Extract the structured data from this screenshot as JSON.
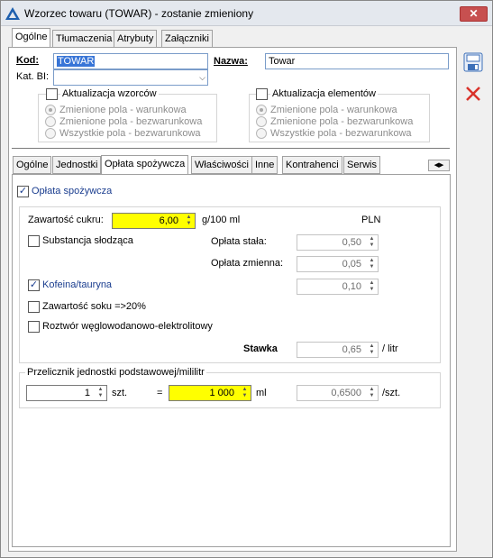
{
  "window": {
    "title": "Wzorzec towaru (TOWAR) - zostanie zmieniony",
    "close": "✕"
  },
  "top_tabs": [
    "Ogólne",
    "Tłumaczenia",
    "Atrybuty",
    "Załączniki"
  ],
  "fields": {
    "kod_label": "Kod:",
    "kod_value": "TOWAR",
    "kat_label": "Kat. BI:",
    "kat_value": "",
    "nazwa_label": "Nazwa:",
    "nazwa_value": "Towar"
  },
  "aktualizacja_wzorcow": {
    "label": "Aktualizacja wzorców",
    "options": [
      "Zmienione pola - warunkowa",
      "Zmienione pola - bezwarunkowa",
      "Wszystkie pola - bezwarunkowa"
    ]
  },
  "aktualizacja_elementow": {
    "label": "Aktualizacja elementów",
    "options": [
      "Zmienione pola - warunkowa",
      "Zmienione pola - bezwarunkowa",
      "Wszystkie pola - bezwarunkowa"
    ]
  },
  "sub_tabs": [
    "Ogólne",
    "Jednostki",
    "Opłata spożywcza",
    "Właściwości",
    "Inne",
    "Kontrahenci",
    "Serwis"
  ],
  "oplata": {
    "checkbox_label": "Opłata spożywcza",
    "zawartosc_label": "Zawartość cukru:",
    "zawartosc_value": "6,00",
    "zawartosc_unit": "g/100 ml",
    "pln": "PLN",
    "substancja": "Substancja słodząca",
    "oplata_stala_label": "Opłata stała:",
    "oplata_stala_value": "0,50",
    "oplata_zmienna_label": "Opłata zmienna:",
    "oplata_zmienna_value": "0,05",
    "kofeina": "Kofeina/tauryna",
    "kofeina_value": "0,10",
    "sok": "Zawartość soku =>20%",
    "roztwor": "Roztwór węglowodanowo-elektrolitowy",
    "stawka_label": "Stawka",
    "stawka_value": "0,65",
    "stawka_unit": "/ litr"
  },
  "przelicznik": {
    "label": "Przelicznik jednostki podstawowej/mililitr",
    "left_value": "1",
    "left_unit": "szt.",
    "equals": "=",
    "right_value": "1 000",
    "right_unit": "ml",
    "result_value": "0,6500",
    "result_unit": "/szt."
  }
}
